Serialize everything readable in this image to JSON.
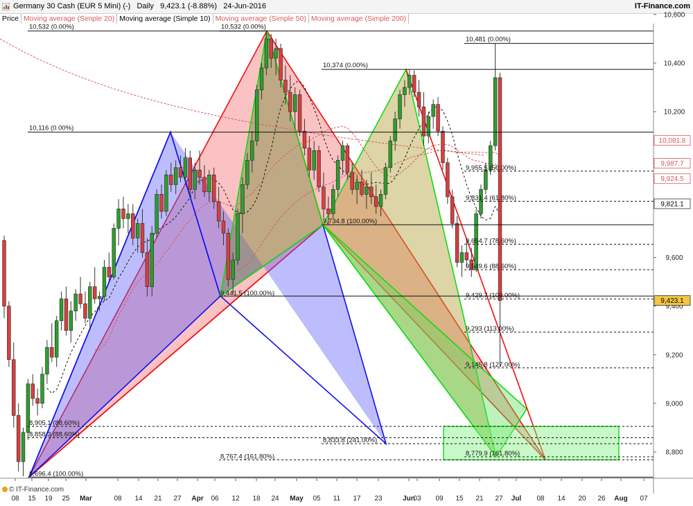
{
  "header": {
    "title": "Germany 30 Cash (EUR 5 Mini) (-)   Daily   9,423.1 (-8.88%)   24-Jun-2016",
    "brand": "IT-Finance.com"
  },
  "legend": {
    "price": "Price",
    "ma20": "Moving average (Simple 20)",
    "ma10": "Moving average (Simple 10)",
    "ma50": "Moving average (Simple 50)",
    "ma200": "Moving average (Simple 200)"
  },
  "footer": {
    "copyright": "© IT-Finance.com"
  },
  "colors": {
    "up": "#2e9e2e",
    "down": "#d84040",
    "blue": "#1010ee",
    "red": "#ee1010",
    "green": "#10dd10",
    "ma_red": "#d85a5a",
    "price_badge": "#f5c542"
  },
  "chart_data": {
    "type": "candlestick",
    "title": "Germany 30 Cash (EUR 5 Mini) (-)",
    "ylim": [
      8680,
      10620
    ],
    "y_ticks": [
      "10,600",
      "10,400",
      "10,200",
      "10,000",
      "9,600",
      "9,400",
      "9,200",
      "9,000",
      "8,800"
    ],
    "x_ticks": [
      "08",
      "15",
      "19",
      "25",
      "Mar",
      "08",
      "14",
      "21",
      "27",
      "Apr",
      "06",
      "12",
      "18",
      "24",
      "May",
      "05",
      "11",
      "17",
      "23",
      "Jun",
      "03",
      "09",
      "15",
      "21",
      "27",
      "Jul",
      "08",
      "14",
      "20",
      "26",
      "Aug",
      "07"
    ],
    "axis_badges": [
      {
        "label": "10,081.8",
        "value": 10081.8,
        "style": "red"
      },
      {
        "label": "9,987.7",
        "value": 9987.7,
        "style": "red"
      },
      {
        "label": "9,924.5",
        "value": 9924.5,
        "style": "red"
      },
      {
        "label": "9,821.1",
        "value": 9821.1,
        "style": "black"
      },
      {
        "label": "9,423.1",
        "value": 9423.1,
        "style": "price"
      }
    ],
    "levels": [
      {
        "label": "10,532 (0.00%)",
        "value": 10532
      },
      {
        "label": "10,532 (0.00%)",
        "value": 10532
      },
      {
        "label": "10,481 (0.00%)",
        "value": 10481
      },
      {
        "label": "10,374 (0.00%)",
        "value": 10374
      },
      {
        "label": "10,116 (0.00%)",
        "value": 10116
      },
      {
        "label": "9,955.5 (50.00%)",
        "value": 9955.5
      },
      {
        "label": "9,831.4 (61.80%)",
        "value": 9831.4
      },
      {
        "label": "9,734.8 (100.00%)",
        "value": 9734.8
      },
      {
        "label": "9,654.7 (78.60%)",
        "value": 9654.7
      },
      {
        "label": "9,549.6 (88.60%)",
        "value": 9549.6
      },
      {
        "label": "9,441.5 (100.00%)",
        "value": 9441.5
      },
      {
        "label": "9,429.7 (100.00%)",
        "value": 9429.7
      },
      {
        "label": "9,293 (113.00%)",
        "value": 9293
      },
      {
        "label": "9,145.8 (127.00%)",
        "value": 9145.8
      },
      {
        "label": "8,905.1 (88.60%)",
        "value": 8905.1
      },
      {
        "label": "8,858.3 (88.60%)",
        "value": 8858.3
      },
      {
        "label": "8,833.8 (241.00%)",
        "value": 8833.8
      },
      {
        "label": "8,779.9 (161.80%)",
        "value": 8779.9
      },
      {
        "label": "8,767.4 (161.80%)",
        "value": 8767.4
      },
      {
        "label": "8,696.4 (100.00%)",
        "value": 8696.4
      }
    ],
    "candles": [
      [
        9670,
        9690,
        9350,
        9400
      ],
      [
        9400,
        9420,
        9150,
        9180
      ],
      [
        9180,
        9250,
        8900,
        8950
      ],
      [
        8950,
        9000,
        8720,
        8760
      ],
      [
        8760,
        8900,
        8700,
        8880
      ],
      [
        8880,
        9100,
        8850,
        9080
      ],
      [
        9080,
        9120,
        8990,
        9020
      ],
      [
        9020,
        9060,
        8950,
        9000
      ],
      [
        9000,
        9150,
        8980,
        9120
      ],
      [
        9120,
        9260,
        9080,
        9230
      ],
      [
        9230,
        9330,
        9170,
        9190
      ],
      [
        9190,
        9360,
        9150,
        9340
      ],
      [
        9340,
        9460,
        9300,
        9430
      ],
      [
        9430,
        9480,
        9280,
        9300
      ],
      [
        9300,
        9420,
        9250,
        9380
      ],
      [
        9380,
        9470,
        9340,
        9450
      ],
      [
        9450,
        9520,
        9390,
        9410
      ],
      [
        9410,
        9460,
        9330,
        9350
      ],
      [
        9350,
        9500,
        9300,
        9480
      ],
      [
        9480,
        9560,
        9410,
        9430
      ],
      [
        9430,
        9460,
        9380,
        9440
      ],
      [
        9440,
        9590,
        9420,
        9560
      ],
      [
        9560,
        9620,
        9500,
        9520
      ],
      [
        9520,
        9740,
        9510,
        9720
      ],
      [
        9720,
        9840,
        9650,
        9800
      ],
      [
        9800,
        9850,
        9720,
        9760
      ],
      [
        9760,
        9820,
        9700,
        9780
      ],
      [
        9780,
        9820,
        9650,
        9680
      ],
      [
        9680,
        9760,
        9620,
        9740
      ],
      [
        9740,
        9800,
        9600,
        9620
      ],
      [
        9620,
        9680,
        9440,
        9480
      ],
      [
        9480,
        9730,
        9440,
        9700
      ],
      [
        9700,
        9880,
        9680,
        9860
      ],
      [
        9860,
        9900,
        9760,
        9790
      ],
      [
        9790,
        9960,
        9770,
        9940
      ],
      [
        9940,
        9990,
        9870,
        9900
      ],
      [
        9900,
        10000,
        9860,
        9970
      ],
      [
        9970,
        10020,
        9910,
        9930
      ],
      [
        9930,
        10050,
        9900,
        10010
      ],
      [
        10010,
        10040,
        9850,
        9880
      ],
      [
        9880,
        9990,
        9840,
        9960
      ],
      [
        9960,
        10040,
        9900,
        9930
      ],
      [
        9930,
        9980,
        9850,
        9870
      ],
      [
        9870,
        9960,
        9830,
        9940
      ],
      [
        9940,
        9970,
        9800,
        9830
      ],
      [
        9830,
        9890,
        9720,
        9750
      ],
      [
        9750,
        9790,
        9650,
        9700
      ],
      [
        9700,
        9720,
        9480,
        9510
      ],
      [
        9510,
        9620,
        9450,
        9590
      ],
      [
        9590,
        9800,
        9570,
        9780
      ],
      [
        9780,
        9930,
        9700,
        9900
      ],
      [
        9900,
        10030,
        9880,
        10000
      ],
      [
        10000,
        10120,
        9950,
        10080
      ],
      [
        10080,
        10310,
        10060,
        10290
      ],
      [
        10290,
        10400,
        10250,
        10380
      ],
      [
        10380,
        10532,
        10350,
        10500
      ],
      [
        10500,
        10520,
        10380,
        10420
      ],
      [
        10420,
        10500,
        10350,
        10460
      ],
      [
        10460,
        10480,
        10300,
        10330
      ],
      [
        10330,
        10390,
        10230,
        10280
      ],
      [
        10280,
        10350,
        10160,
        10200
      ],
      [
        10200,
        10300,
        10130,
        10270
      ],
      [
        10270,
        10290,
        10100,
        10120
      ],
      [
        10120,
        10170,
        10020,
        10050
      ],
      [
        10050,
        10100,
        9930,
        9960
      ],
      [
        9960,
        10080,
        9920,
        10040
      ],
      [
        10040,
        10060,
        9870,
        9890
      ],
      [
        9890,
        9950,
        9760,
        9800
      ],
      [
        9800,
        9850,
        9734,
        9780
      ],
      [
        9780,
        9900,
        9760,
        9880
      ],
      [
        9880,
        10020,
        9850,
        10000
      ],
      [
        10000,
        10080,
        9940,
        10060
      ],
      [
        10060,
        10070,
        9920,
        9950
      ],
      [
        9950,
        9990,
        9860,
        9880
      ],
      [
        9880,
        9940,
        9820,
        9910
      ],
      [
        9910,
        9960,
        9850,
        9860
      ],
      [
        9860,
        9920,
        9800,
        9890
      ],
      [
        9890,
        9950,
        9820,
        9850
      ],
      [
        9850,
        9900,
        9780,
        9810
      ],
      [
        9810,
        9880,
        9770,
        9860
      ],
      [
        9860,
        9990,
        9840,
        9970
      ],
      [
        9970,
        10100,
        9950,
        10080
      ],
      [
        10080,
        10200,
        10040,
        10170
      ],
      [
        10170,
        10290,
        10130,
        10270
      ],
      [
        10270,
        10330,
        10220,
        10300
      ],
      [
        10300,
        10374,
        10270,
        10350
      ],
      [
        10350,
        10370,
        10260,
        10280
      ],
      [
        10280,
        10330,
        10180,
        10220
      ],
      [
        10220,
        10280,
        10060,
        10100
      ],
      [
        10100,
        10200,
        10070,
        10180
      ],
      [
        10180,
        10250,
        10130,
        10230
      ],
      [
        10230,
        10260,
        10100,
        10120
      ],
      [
        10120,
        10140,
        9960,
        9990
      ],
      [
        9990,
        10010,
        9820,
        9850
      ],
      [
        9850,
        9880,
        9720,
        9740
      ],
      [
        9740,
        9770,
        9560,
        9580
      ],
      [
        9580,
        9650,
        9520,
        9620
      ],
      [
        9620,
        9680,
        9560,
        9590
      ],
      [
        9590,
        9640,
        9520,
        9550
      ],
      [
        9550,
        9800,
        9540,
        9780
      ],
      [
        9780,
        9900,
        9760,
        9880
      ],
      [
        9880,
        9990,
        9860,
        9960
      ],
      [
        9960,
        10080,
        9940,
        10060
      ],
      [
        10060,
        10481,
        10040,
        10340
      ],
      [
        10340,
        10360,
        9150,
        9423.1
      ]
    ],
    "ma10_dashed": true,
    "patterns": [
      {
        "name": "blue",
        "points": [
          [
            "x",
            8696.4
          ],
          [
            "x",
            10116
          ],
          [
            "x",
            9441.5
          ],
          [
            "x",
            8833.8
          ]
        ]
      },
      {
        "name": "red",
        "points": [
          [
            "x",
            8696.4
          ],
          [
            "x",
            10532
          ],
          [
            "x",
            9734.8
          ],
          [
            "x",
            8779.9
          ]
        ]
      },
      {
        "name": "green-olive",
        "points": [
          [
            "x",
            9441.5
          ],
          [
            "x",
            10532
          ],
          [
            "x",
            9734.8
          ],
          [
            "x",
            10374
          ],
          [
            "x",
            8779.9
          ]
        ]
      }
    ]
  }
}
